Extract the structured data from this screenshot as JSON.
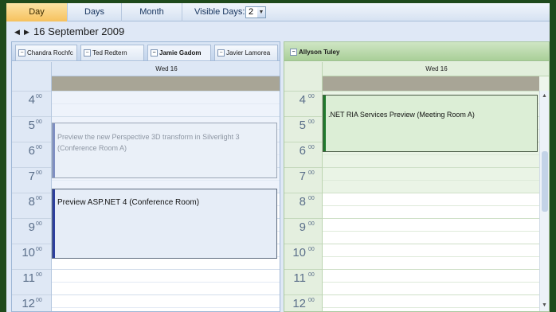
{
  "toolbar": {
    "tabs": [
      {
        "label": "Day",
        "active": true
      },
      {
        "label": "Days",
        "active": false
      },
      {
        "label": "Month",
        "active": false
      }
    ],
    "visible_days_label": "Visible Days:",
    "visible_days_value": "2"
  },
  "date_nav": {
    "current_date": "16 September 2009"
  },
  "left_panel": {
    "resources": [
      "Chandra Rochfc",
      "Ted Redtern",
      "Jamie Gadom",
      "Javier Lamorea"
    ],
    "active_resource": "Jamie Gadom",
    "day_header": "Wed 16",
    "appointments": [
      {
        "title": "Preview the new Perspective 3D transform in Silverlight 3 (Conference Room A)",
        "start": "5:00",
        "end": "7:00",
        "tentative": true
      },
      {
        "title": "Preview ASP.NET 4 (Conference Room)",
        "start": "7:30",
        "end": "10:00"
      }
    ]
  },
  "right_panel": {
    "resource": "Allyson Tuley",
    "day_header": "Wed 16",
    "appointments": [
      {
        "title": ".NET RIA Services Preview (Meeting Room A)",
        "start": "4:00",
        "end": "6:00"
      }
    ]
  },
  "hours": [
    {
      "h": "4",
      "m": "00"
    },
    {
      "h": "5",
      "m": "00"
    },
    {
      "h": "6",
      "m": "00"
    },
    {
      "h": "7",
      "m": "00"
    },
    {
      "h": "8",
      "m": "00"
    },
    {
      "h": "9",
      "m": "00"
    },
    {
      "h": "10",
      "m": "00"
    },
    {
      "h": "11",
      "m": "00"
    },
    {
      "h": "12",
      "m": "00"
    }
  ],
  "colors": {
    "active_tab": "#f6c15d",
    "left_panel_bg": "#eef3fb",
    "right_panel_bg": "#eef6ec",
    "allday_band": "#a8a596",
    "appt_bar_blue": "#2d3f9e",
    "appt_bar_green": "#1f7a2c"
  },
  "icons": {
    "prev": "left-triangle",
    "next": "right-triangle",
    "resource": "calendar-toggle",
    "scroll_up": "up-triangle"
  }
}
